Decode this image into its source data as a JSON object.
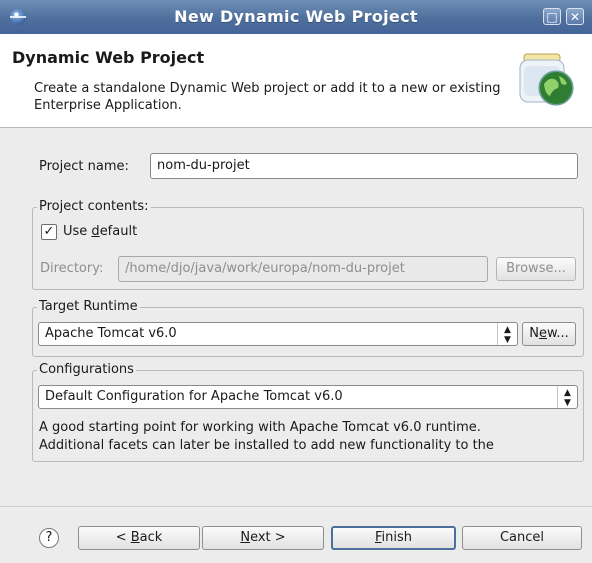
{
  "window": {
    "title": "New Dynamic Web Project",
    "controls": [
      "maximize-icon",
      "close-icon"
    ]
  },
  "header": {
    "title": "Dynamic Web Project",
    "description": "Create a standalone Dynamic Web project or add it to a new or existing Enterprise Application."
  },
  "project_name": {
    "label": "Project name:",
    "value": "nom-du-projet"
  },
  "project_contents": {
    "legend": "Project contents:",
    "use_default_pre": "Use ",
    "use_default_mnemonic": "d",
    "use_default_post": "efault",
    "use_default_checked": true,
    "check_mark": "✓",
    "directory_label": "Directory:",
    "directory_value": "/home/djo/java/work/europa/nom-du-projet",
    "browse_label": "Browse..."
  },
  "target_runtime": {
    "legend": "Target Runtime",
    "selected": "Apache Tomcat v6.0",
    "new_pre": "N",
    "new_mnemonic": "e",
    "new_post": "w..."
  },
  "configurations": {
    "legend": "Configurations",
    "selected": "Default Configuration for Apache Tomcat v6.0",
    "description_line1": "A good starting point for working with Apache Tomcat v6.0 runtime.",
    "description_line2": "Additional facets can later be installed to add new functionality to the"
  },
  "buttons": {
    "help": "?",
    "back_pre": "< ",
    "back_mnemonic": "B",
    "back_post": "ack",
    "next_mnemonic": "N",
    "next_post": "ext >",
    "finish_mnemonic": "F",
    "finish_post": "inish",
    "cancel": "Cancel"
  },
  "colors": {
    "titlebar": "#4e6f9c",
    "dialog_bg": "#ececec",
    "disabled_text": "#8e8e8e"
  }
}
